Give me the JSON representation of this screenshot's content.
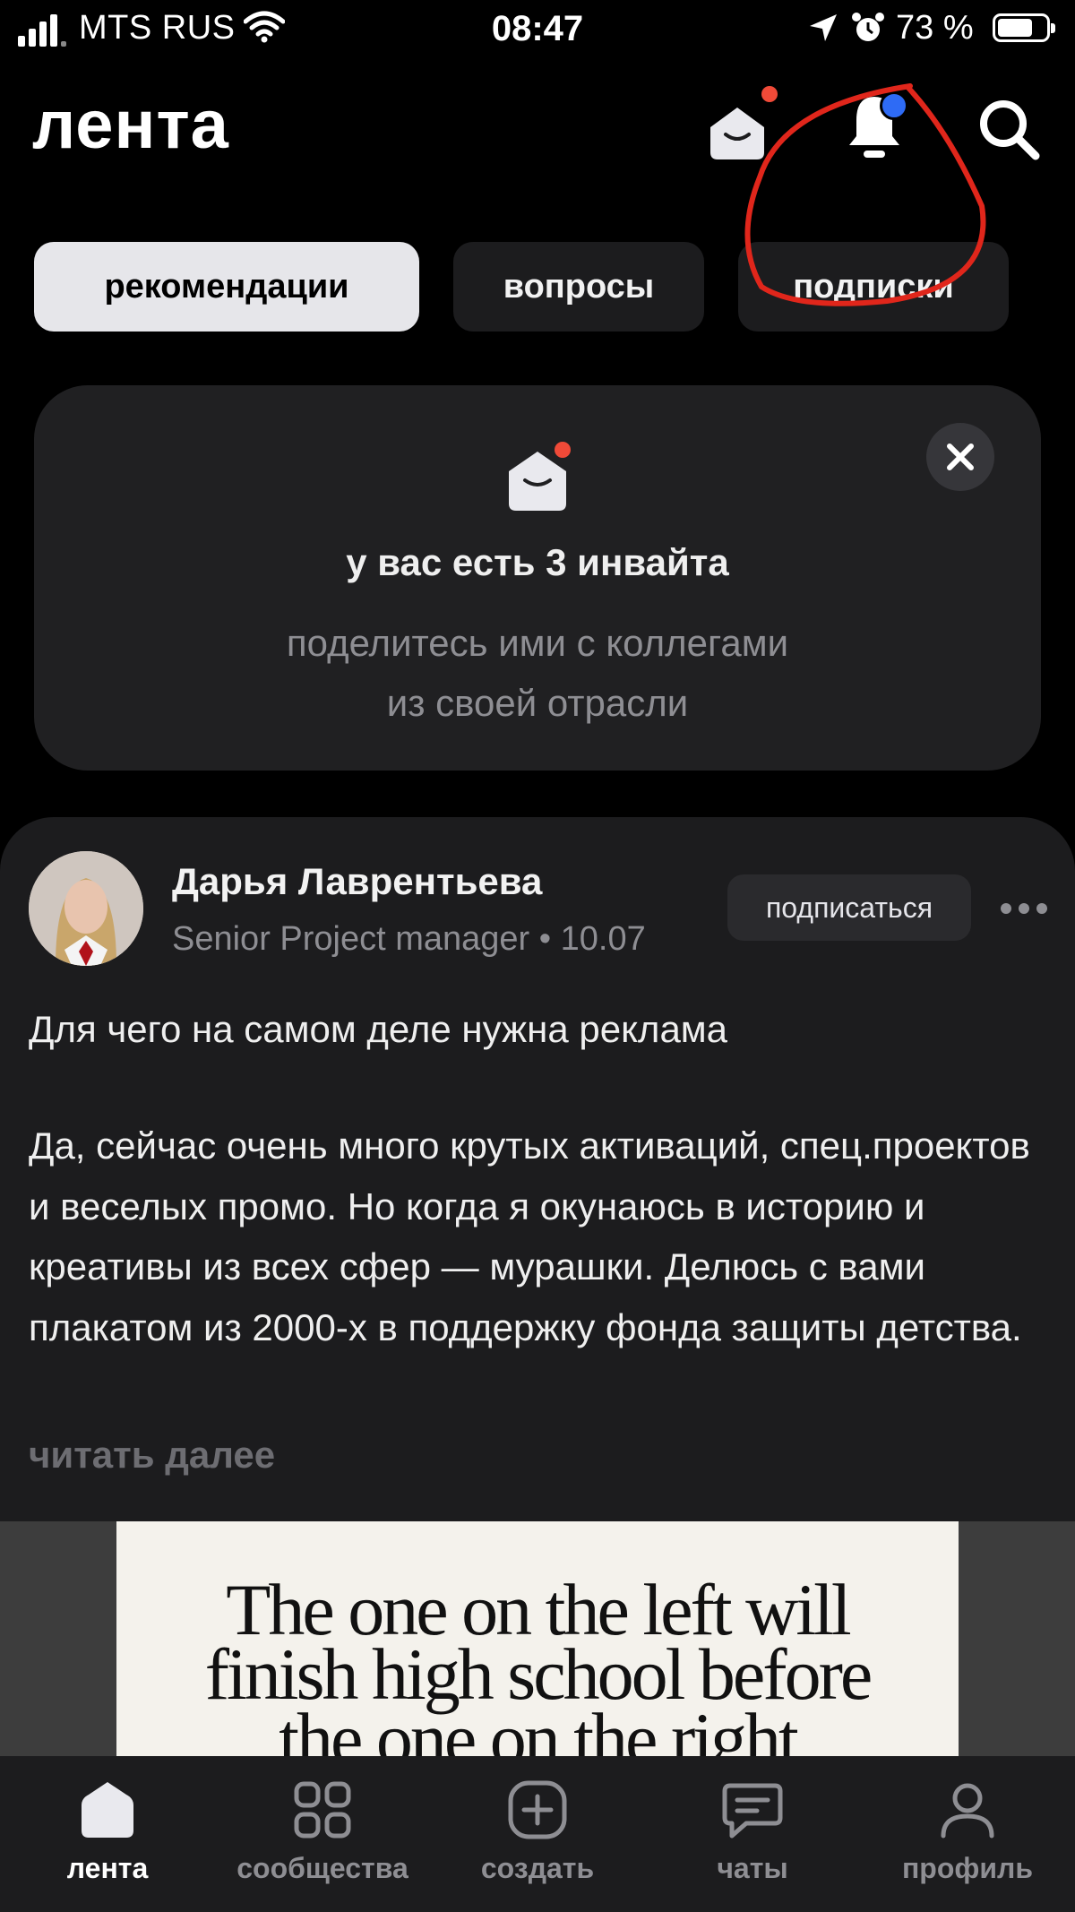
{
  "status_bar": {
    "carrier": "MTS RUS",
    "time": "08:47",
    "battery_percent": "73 %",
    "battery_level": 0.73
  },
  "header": {
    "logo": "лента",
    "icons": [
      "invites-envelope-icon",
      "bell-icon",
      "search-icon"
    ]
  },
  "tabs": [
    {
      "label": "рекомендации",
      "active": true
    },
    {
      "label": "вопросы",
      "active": false
    },
    {
      "label": "подписки",
      "active": false
    }
  ],
  "invite_card": {
    "title": "у вас есть 3 инвайта",
    "subtitle_line1": "поделитесь ими с коллегами",
    "subtitle_line2": "из своей отрасли"
  },
  "post": {
    "author": "Дарья Лаврентьева",
    "role": "Senior Project manager",
    "date": "10.07",
    "subscribe_label": "подписаться",
    "title": "Для чего на самом деле нужна реклама",
    "body": "Да, сейчас очень много крутых активаций, спец.проектов и веселых промо. Но когда я окунаюсь в историю и креативы из всех сфер — мурашки. Делюсь с вами плакатом из 2000-х в поддержку фонда защиты детства.",
    "read_more": "читать далее",
    "image_text_line1": "The one on the left will",
    "image_text_line2": "finish high school before",
    "image_text_line3": "the one on the right"
  },
  "bottom_nav": [
    {
      "label": "лента",
      "icon": "home-icon",
      "active": true
    },
    {
      "label": "сообщества",
      "icon": "grid-icon",
      "active": false
    },
    {
      "label": "создать",
      "icon": "plus-square-icon",
      "active": false
    },
    {
      "label": "чаты",
      "icon": "chat-icon",
      "active": false
    },
    {
      "label": "профиль",
      "icon": "profile-icon",
      "active": false
    }
  ],
  "colors": {
    "accent_red": "#f04a38",
    "notification_blue": "#2e6bf5",
    "annotation_red": "#e0261b"
  }
}
